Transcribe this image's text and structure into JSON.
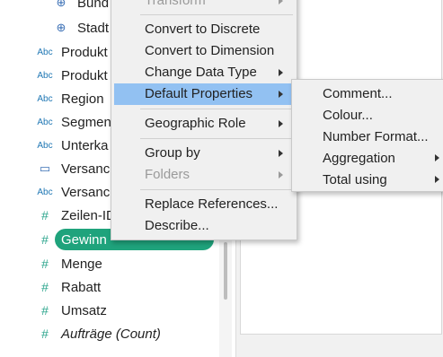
{
  "data_pane": {
    "fields": [
      {
        "icon": "globe-icon",
        "glyph": "⊕",
        "label": "Bund",
        "indent": true
      },
      {
        "icon": "globe-icon",
        "glyph": "⊕",
        "label": "Stadt",
        "indent": true
      },
      {
        "icon": "abc-string-icon",
        "glyph": "Abc",
        "label": "Produkt"
      },
      {
        "icon": "abc-string-icon",
        "glyph": "Abc",
        "label": "Produkt"
      },
      {
        "icon": "abc-string-icon",
        "glyph": "Abc",
        "label": "Region"
      },
      {
        "icon": "abc-string-icon",
        "glyph": "Abc",
        "label": "Segmen"
      },
      {
        "icon": "abc-string-icon",
        "glyph": "Abc",
        "label": "Unterka"
      },
      {
        "icon": "calendar-icon",
        "glyph": "▭",
        "label": "Versanc"
      },
      {
        "icon": "abc-string-icon",
        "glyph": "Abc",
        "label": "Versanc"
      },
      {
        "icon": "hash-icon",
        "glyph": "#",
        "label": "Zeilen-ID"
      },
      {
        "icon": "hash-icon",
        "glyph": "#",
        "label": "Gewinn",
        "selected": true
      },
      {
        "icon": "hash-icon",
        "glyph": "#",
        "label": "Menge"
      },
      {
        "icon": "hash-icon",
        "glyph": "#",
        "label": "Rabatt"
      },
      {
        "icon": "hash-icon",
        "glyph": "#",
        "label": "Umsatz"
      },
      {
        "icon": "hash-icon",
        "glyph": "#",
        "label": "Aufträge (Count)",
        "italic": true
      }
    ]
  },
  "context_menu": {
    "items": [
      {
        "label": "Transform",
        "disabled": true,
        "submenu": true
      },
      {
        "label": "Convert to Discrete"
      },
      {
        "label": "Convert to Dimension"
      },
      {
        "label": "Change Data Type",
        "submenu": true
      },
      {
        "label": "Default Properties",
        "submenu": true,
        "highlight": true
      },
      {
        "label": "Geographic Role",
        "submenu": true
      },
      {
        "label": "Group by",
        "submenu": true
      },
      {
        "label": "Folders",
        "submenu": true,
        "disabled": true
      },
      {
        "label": "Replace References..."
      },
      {
        "label": "Describe..."
      }
    ]
  },
  "default_properties_submenu": {
    "items": [
      {
        "label": "Comment..."
      },
      {
        "label": "Colour..."
      },
      {
        "label": "Number Format..."
      },
      {
        "label": "Aggregation",
        "submenu": true
      },
      {
        "label": "Total using",
        "submenu": true
      }
    ]
  },
  "colors": {
    "selected_pill": "#1fa37c",
    "menu_highlight": "#92c1f2",
    "menu_bg": "#f0f0f0"
  }
}
